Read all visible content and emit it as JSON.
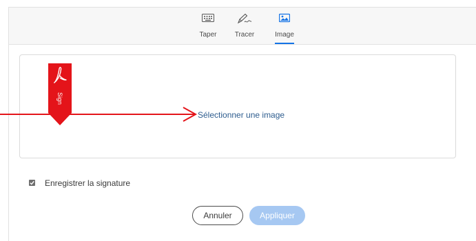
{
  "tabs": [
    {
      "label": "Taper",
      "icon": "keyboard-icon",
      "active": false
    },
    {
      "label": "Tracer",
      "icon": "pen-draw-icon",
      "active": false
    },
    {
      "label": "Image",
      "icon": "image-icon",
      "active": true
    }
  ],
  "panel": {
    "select_image_label": "Sélectionner une image",
    "sign_flag_text": "Sign"
  },
  "save": {
    "label": "Enregistrer la signature",
    "checked": true
  },
  "buttons": {
    "cancel_label": "Annuler",
    "apply_label": "Appliquer",
    "apply_disabled": true
  },
  "colors": {
    "accent": "#1473e6",
    "link": "#2d5c8e",
    "annotation_red": "#e4141a",
    "apply_disabled_bg": "#a6c8f2"
  }
}
